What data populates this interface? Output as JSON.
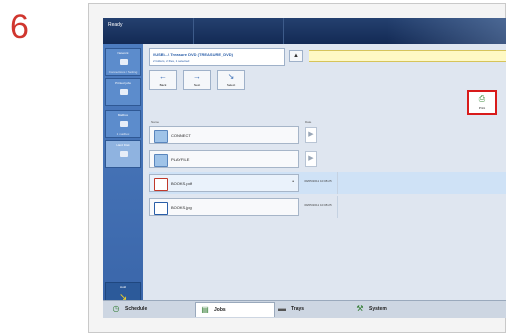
{
  "step_number": "6",
  "window": {
    "title": "Ready"
  },
  "sidebar": {
    "items": [
      {
        "label": "Network",
        "sub": "Connections / Setting"
      },
      {
        "label": "Printed jobs",
        "sub": ""
      },
      {
        "label": "Mailbox",
        "sub": "1 mailbox"
      },
      {
        "label": "Hard Disk",
        "sub": ""
      }
    ],
    "bottom": {
      "label": "Hold",
      "sub": "Scan"
    }
  },
  "path": {
    "line1": "\\\\USB\\...\\ Treasure DVD (TREASURE_DVD)",
    "line2": "2 folders, 2 files, 1 selected"
  },
  "toolbar": {
    "up_label": "▲",
    "back_label": "Back",
    "next_label": "Next",
    "select_label": "Select",
    "print_label": "Print"
  },
  "columns": {
    "name": "Name",
    "date": "Date"
  },
  "files": [
    {
      "name": "CONNECT",
      "type": "folder",
      "date": ""
    },
    {
      "name": "PLAYFILE",
      "type": "folder",
      "date": ""
    },
    {
      "name": "BOOKS.pdf",
      "type": "pdf",
      "date": "09/05/2011 10:08:25"
    },
    {
      "name": "BOOKS.jpg",
      "type": "image",
      "date": "09/05/2011 10:08:25"
    }
  ],
  "taskbar": {
    "tabs": [
      {
        "label": "Schedule",
        "icon": "clock-icon"
      },
      {
        "label": "Jobs",
        "icon": "document-icon"
      },
      {
        "label": "Trays",
        "icon": "tray-icon"
      },
      {
        "label": "System",
        "icon": "wrench-icon"
      }
    ]
  },
  "colors": {
    "highlight": "#d81b1b",
    "step": "#d0362e",
    "sidebar": "#4d7cbf"
  }
}
